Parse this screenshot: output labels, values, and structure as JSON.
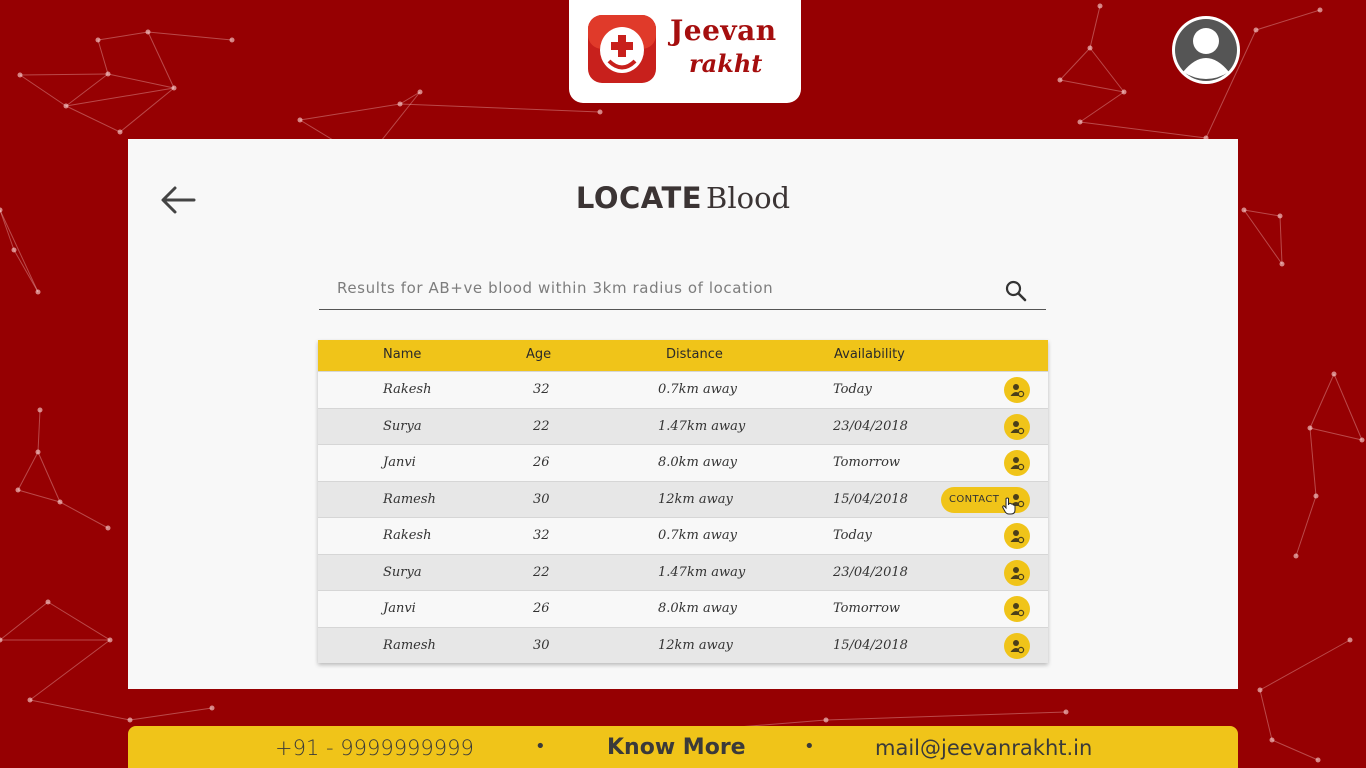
{
  "brand": {
    "line1": "Jeevan",
    "line2": "rakht"
  },
  "header": {
    "title_strong": "LOCATE",
    "title_light": "Blood"
  },
  "search": {
    "placeholder": "Results for AB+ve blood within 3km radius of location"
  },
  "table": {
    "columns": [
      "Name",
      "Age",
      "Distance",
      "Availability"
    ],
    "contact_label": "CONTACT",
    "rows": [
      {
        "name": "Rakesh",
        "age": "32",
        "distance": "0.7km away",
        "availability": "Today"
      },
      {
        "name": "Surya",
        "age": "22",
        "distance": "1.47km away",
        "availability": "23/04/2018"
      },
      {
        "name": "Janvi",
        "age": "26",
        "distance": "8.0km away",
        "availability": "Tomorrow"
      },
      {
        "name": "Ramesh",
        "age": "30",
        "distance": "12km away",
        "availability": "15/04/2018"
      },
      {
        "name": "Rakesh",
        "age": "32",
        "distance": "0.7km away",
        "availability": "Today"
      },
      {
        "name": "Surya",
        "age": "22",
        "distance": "1.47km away",
        "availability": "23/04/2018"
      },
      {
        "name": "Janvi",
        "age": "26",
        "distance": "8.0km away",
        "availability": "Tomorrow"
      },
      {
        "name": "Ramesh",
        "age": "30",
        "distance": "12km away",
        "availability": "15/04/2018"
      }
    ]
  },
  "footer": {
    "phone": "+91 - 9999999999",
    "separator": "•",
    "know_more": "Know More",
    "email": "mail@jeevanrakht.in"
  },
  "colors": {
    "background": "#960002",
    "accent": "#f0c419",
    "card": "#f8f8f8",
    "brand_red": "#a50e0e"
  },
  "icons": [
    "back-arrow-icon",
    "search-icon",
    "person-pin-icon",
    "user-avatar-icon",
    "hand-cursor-icon",
    "blood-drop-logo-icon"
  ]
}
